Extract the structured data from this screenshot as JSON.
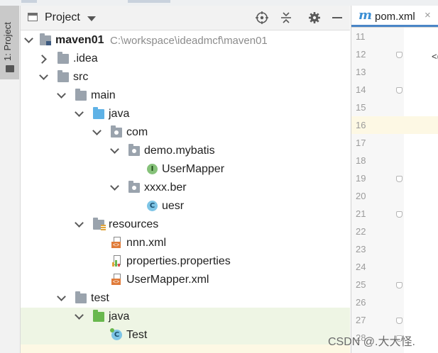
{
  "stripe": {
    "label": "1: Project"
  },
  "panel": {
    "title": "Project",
    "tree": [
      {
        "label": "maven01",
        "path": "C:\\workspace\\ideadmcf\\maven01",
        "icon": "module-folder-icon",
        "chev": "down"
      },
      {
        "label": ".idea",
        "icon": "folder-icon",
        "chev": "right"
      },
      {
        "label": "src",
        "icon": "folder-icon",
        "chev": "down"
      },
      {
        "label": "main",
        "icon": "folder-icon",
        "chev": "down"
      },
      {
        "label": "java",
        "icon": "source-folder-icon",
        "chev": "down"
      },
      {
        "label": "com",
        "icon": "package-icon",
        "chev": "down"
      },
      {
        "label": "demo.mybatis",
        "icon": "package-icon",
        "chev": "down"
      },
      {
        "label": "UserMapper",
        "icon": "interface-icon",
        "chev": ""
      },
      {
        "label": "xxxx.ber",
        "icon": "package-icon",
        "chev": "down"
      },
      {
        "label": "uesr",
        "icon": "class-icon",
        "chev": ""
      },
      {
        "label": "resources",
        "icon": "resources-folder-icon",
        "chev": "down"
      },
      {
        "label": "nnn.xml",
        "icon": "xml-file-icon",
        "chev": ""
      },
      {
        "label": "properties.properties",
        "icon": "properties-file-icon",
        "chev": ""
      },
      {
        "label": "UserMapper.xml",
        "icon": "xml-file-icon",
        "chev": ""
      },
      {
        "label": "test",
        "icon": "folder-icon",
        "chev": "down"
      },
      {
        "label": "java",
        "icon": "test-folder-icon",
        "chev": "down"
      },
      {
        "label": "Test",
        "icon": "test-class-icon",
        "chev": ""
      }
    ]
  },
  "editor": {
    "tab": {
      "icon": "m",
      "name": "pom.xml",
      "close": "×"
    },
    "lines": [
      "11",
      "12",
      "13",
      "14",
      "15",
      "16",
      "17",
      "18",
      "19",
      "20",
      "21",
      "22",
      "23",
      "24",
      "25",
      "26",
      "27",
      "28"
    ],
    "code_fragment": "<("
  },
  "watermark": "CSDN @.大大怪."
}
